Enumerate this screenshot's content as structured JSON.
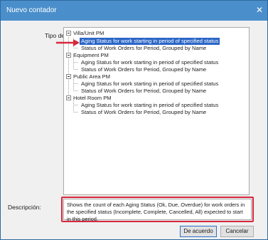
{
  "window": {
    "title": "Nuevo contador",
    "close_glyph": "✕"
  },
  "tipo_label": "Tipo de",
  "description_label": "Descripción:",
  "tree": {
    "groups": [
      {
        "label": "Villa/Unit PM",
        "children": [
          "Aging Status for work starting in period of specified status",
          "Status of Work Orders for Period, Grouped by Name"
        ]
      },
      {
        "label": "Equipment PM",
        "children": [
          "Aging Status for work starting in period of specified status",
          "Status of Work Orders for Period, Grouped by Name"
        ]
      },
      {
        "label": "Public Area PM",
        "children": [
          "Aging Status for work starting in period of specified status",
          "Status of Work Orders for Period, Grouped by Name"
        ]
      },
      {
        "label": "Hotel Room PM",
        "children": [
          "Aging Status for work starting in period of specified status",
          "Status of Work Orders for Period, Grouped by Name"
        ]
      }
    ],
    "selected": "Villa/Unit PM > Aging Status for work starting in period of specified status"
  },
  "description": "Shows the count of each Aging Status (Ok, Due, Overdue) for work orders in the specified status (Incomplete, Complete, Cancelled, All) expected to start in this period.",
  "buttons": {
    "ok": "De acuerdo",
    "cancel": "Cancelar"
  },
  "colors": {
    "titlebar": "#4a8fcb",
    "selection": "#2b66c7",
    "highlight_red": "#d8283c"
  }
}
